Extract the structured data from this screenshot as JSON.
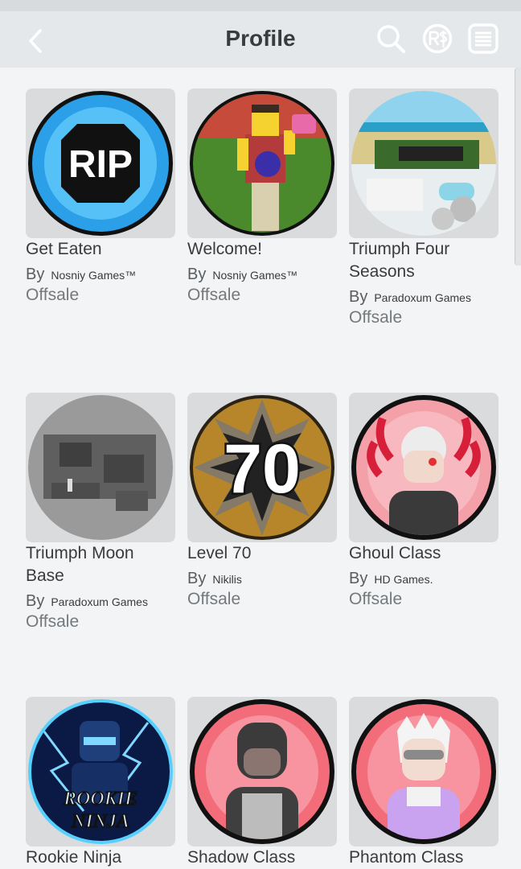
{
  "header": {
    "title": "Profile",
    "back_icon": "chevron-left-icon",
    "search_icon": "search-icon",
    "robux_icon": "robux-icon",
    "menu_icon": "menu-icon"
  },
  "colors": {
    "background": "#f2f4f5",
    "header": "#e5e8ea",
    "card": "#d9dbdd",
    "text": "#393b3d",
    "muted": "#76797c"
  },
  "by_label": "By",
  "badges": [
    {
      "name": "Get Eaten",
      "creator": "Nosniy Games™",
      "status": "Offsale"
    },
    {
      "name": "Welcome!",
      "creator": "Nosniy Games™",
      "status": "Offsale"
    },
    {
      "name": "Triumph Four Seasons",
      "creator": "Paradoxum Games",
      "status": "Offsale"
    },
    {
      "name": "Triumph Moon Base",
      "creator": "Paradoxum Games",
      "status": "Offsale"
    },
    {
      "name": "Level 70",
      "creator": "Nikilis",
      "status": "Offsale"
    },
    {
      "name": "Ghoul Class",
      "creator": "HD Games.",
      "status": "Offsale"
    },
    {
      "name": "Rookie Ninja"
    },
    {
      "name": "Shadow Class"
    },
    {
      "name": "Phantom Class"
    }
  ],
  "thumb_texts": {
    "rip": "RIP",
    "level": "70",
    "rookie_line1": "ROOKIE",
    "rookie_line2": "NINJA"
  }
}
